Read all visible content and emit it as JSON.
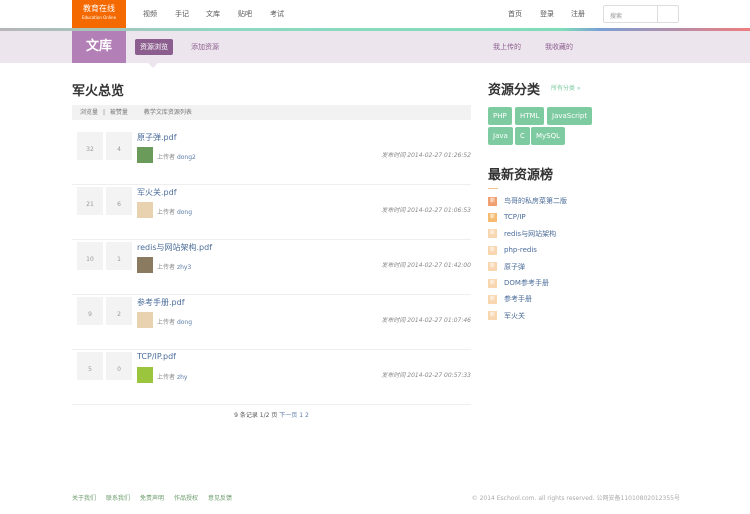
{
  "header": {
    "logo": "教育在线",
    "logo_sub": "Education Online",
    "nav": [
      "视频",
      "手记",
      "文库",
      "贴吧",
      "考试"
    ],
    "right_nav": [
      "首页",
      "登录",
      "注册"
    ],
    "search_placeholder": "搜索"
  },
  "subnav": {
    "section": "文库",
    "tabs": [
      "资源浏览",
      "添加资源"
    ],
    "right_tabs": [
      "我上传的",
      "我收藏的"
    ]
  },
  "main": {
    "title": "军火总览",
    "sort": [
      "浏览量",
      "|",
      "被赞量"
    ],
    "list_title": "教学文库资源列表",
    "items": [
      {
        "views": "32",
        "likes": "4",
        "title": "原子弹.pdf",
        "uploader_label": "上传者",
        "uploader": "dong2",
        "time": "发布时间 2014-02-27 01:26:52",
        "avatar": "#6a9b5a"
      },
      {
        "views": "21",
        "likes": "6",
        "title": "军火关.pdf",
        "uploader_label": "上传者",
        "uploader": "dong",
        "time": "发布时间 2014-02-27 01:06:53",
        "avatar": "#e8d2b0"
      },
      {
        "views": "10",
        "likes": "1",
        "title": "redis与网站架构.pdf",
        "uploader_label": "上传者",
        "uploader": "zhy3",
        "time": "发布时间 2014-02-27 01:42:00",
        "avatar": "#8a7a60"
      },
      {
        "views": "9",
        "likes": "2",
        "title": "参考手册.pdf",
        "uploader_label": "上传者",
        "uploader": "dong",
        "time": "发布时间 2014-02-27 01:07:46",
        "avatar": "#e8d2b0"
      },
      {
        "views": "5",
        "likes": "0",
        "title": "TCP/IP.pdf",
        "uploader_label": "上传者",
        "uploader": "zhy",
        "time": "发布时间 2014-02-27 00:57:33",
        "avatar": "#9bc53d"
      }
    ],
    "pager": {
      "info": "9 条记录 1/2 页",
      "next": "下一页",
      "pages": [
        "1",
        "2"
      ]
    }
  },
  "sidebar": {
    "cat_title": "资源分类",
    "all_link": "所有分类 »",
    "tags": [
      "PHP",
      "HTML",
      "JavaScript",
      "Java",
      "C",
      "MySQL"
    ],
    "rank_title": "最新资源榜",
    "badge": "新",
    "rank": [
      "鸟哥的私房菜第二版",
      "TCP/IP",
      "redis与网站架构",
      "php-redis",
      "原子弹",
      "DOM参考手册",
      "参考手册",
      "军火关"
    ],
    "badge_colors": [
      "#f0a070",
      "#f5bb70",
      "#f8d6b0",
      "#f8d6b0",
      "#f8d6b0",
      "#f8d6b0",
      "#f8d6b0",
      "#f8d6b0"
    ]
  },
  "footer": {
    "links": [
      "关于我们",
      "联系我们",
      "免责声明",
      "作品授权",
      "意见反馈"
    ],
    "copyright": "© 2014 Eschool.com. all rights reserved. 公网安备11010802012355号"
  }
}
